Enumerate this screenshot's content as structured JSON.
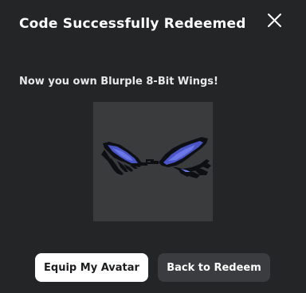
{
  "dialog": {
    "title": "Code Successfully Redeemed",
    "message": "Now you own Blurple 8-Bit Wings!",
    "close_icon": "close-icon",
    "item_image": "blurple-8-bit-wings-thumbnail",
    "primary_button_label": "Equip My Avatar",
    "secondary_button_label": "Back to Redeem"
  },
  "colors": {
    "background": "#232527",
    "thumbnail_bg": "#393b3d",
    "primary_button_bg": "#ffffff",
    "secondary_button_bg": "#3a3c40",
    "wing_blue": "#4a55c8",
    "wing_outline": "#0d0f13"
  }
}
